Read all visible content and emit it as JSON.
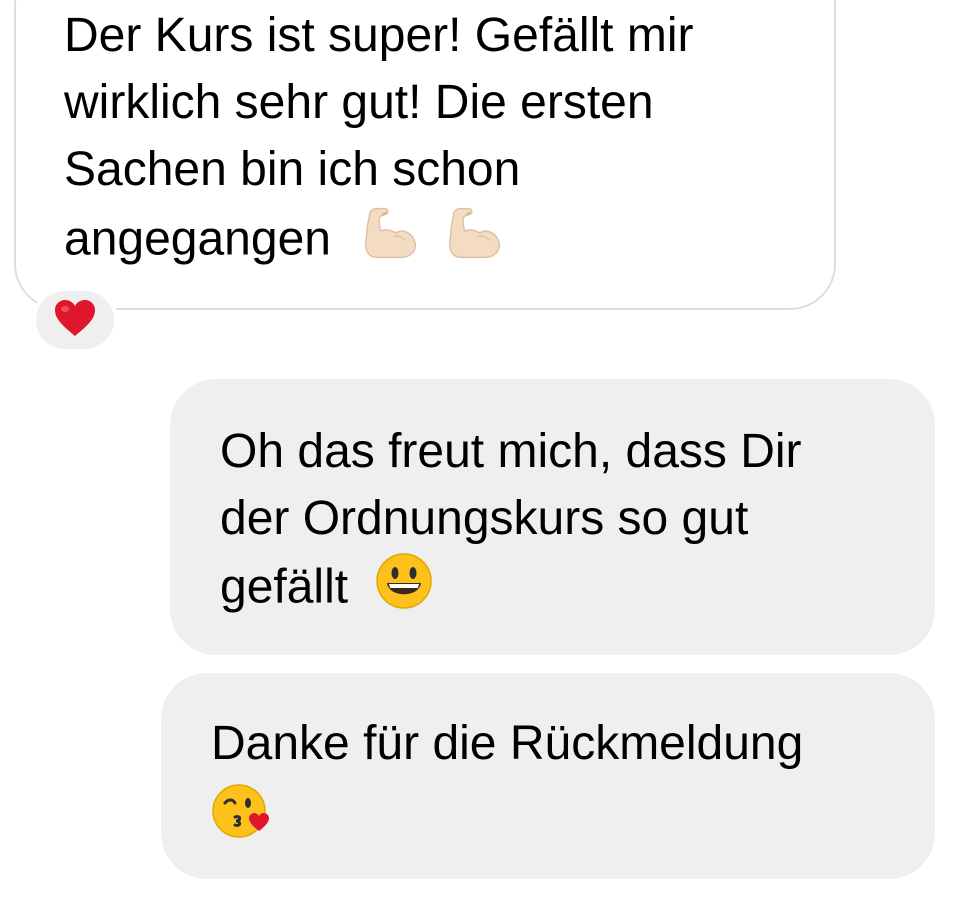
{
  "thread": {
    "messages": [
      {
        "direction": "incoming",
        "lines": [
          "Der Kurs ist super! Gefällt mir",
          "wirklich sehr gut! Die ersten",
          "Sachen bin ich schon",
          "angegangen"
        ],
        "emojis": [
          "flexed-biceps-icon",
          "flexed-biceps-icon"
        ],
        "reaction": "heart-icon"
      },
      {
        "direction": "outgoing",
        "lines": [
          "Oh das freut mich, dass Dir",
          "der Ordnungskurs so gut",
          "gefällt"
        ],
        "emojis": [
          "grinning-face-icon"
        ]
      },
      {
        "direction": "outgoing",
        "lines": [
          "Danke für die Rückmeldung"
        ],
        "emojis": [
          "face-blowing-kiss-icon"
        ]
      }
    ]
  },
  "colors": {
    "incoming_bubble_border": "#dedede",
    "outgoing_bubble_bg": "#efefef",
    "reaction_bg": "#efefef",
    "heart": "#e0162b",
    "emoji_yellow": "#fcc21b",
    "skin_tone": "#f4dcc3"
  }
}
